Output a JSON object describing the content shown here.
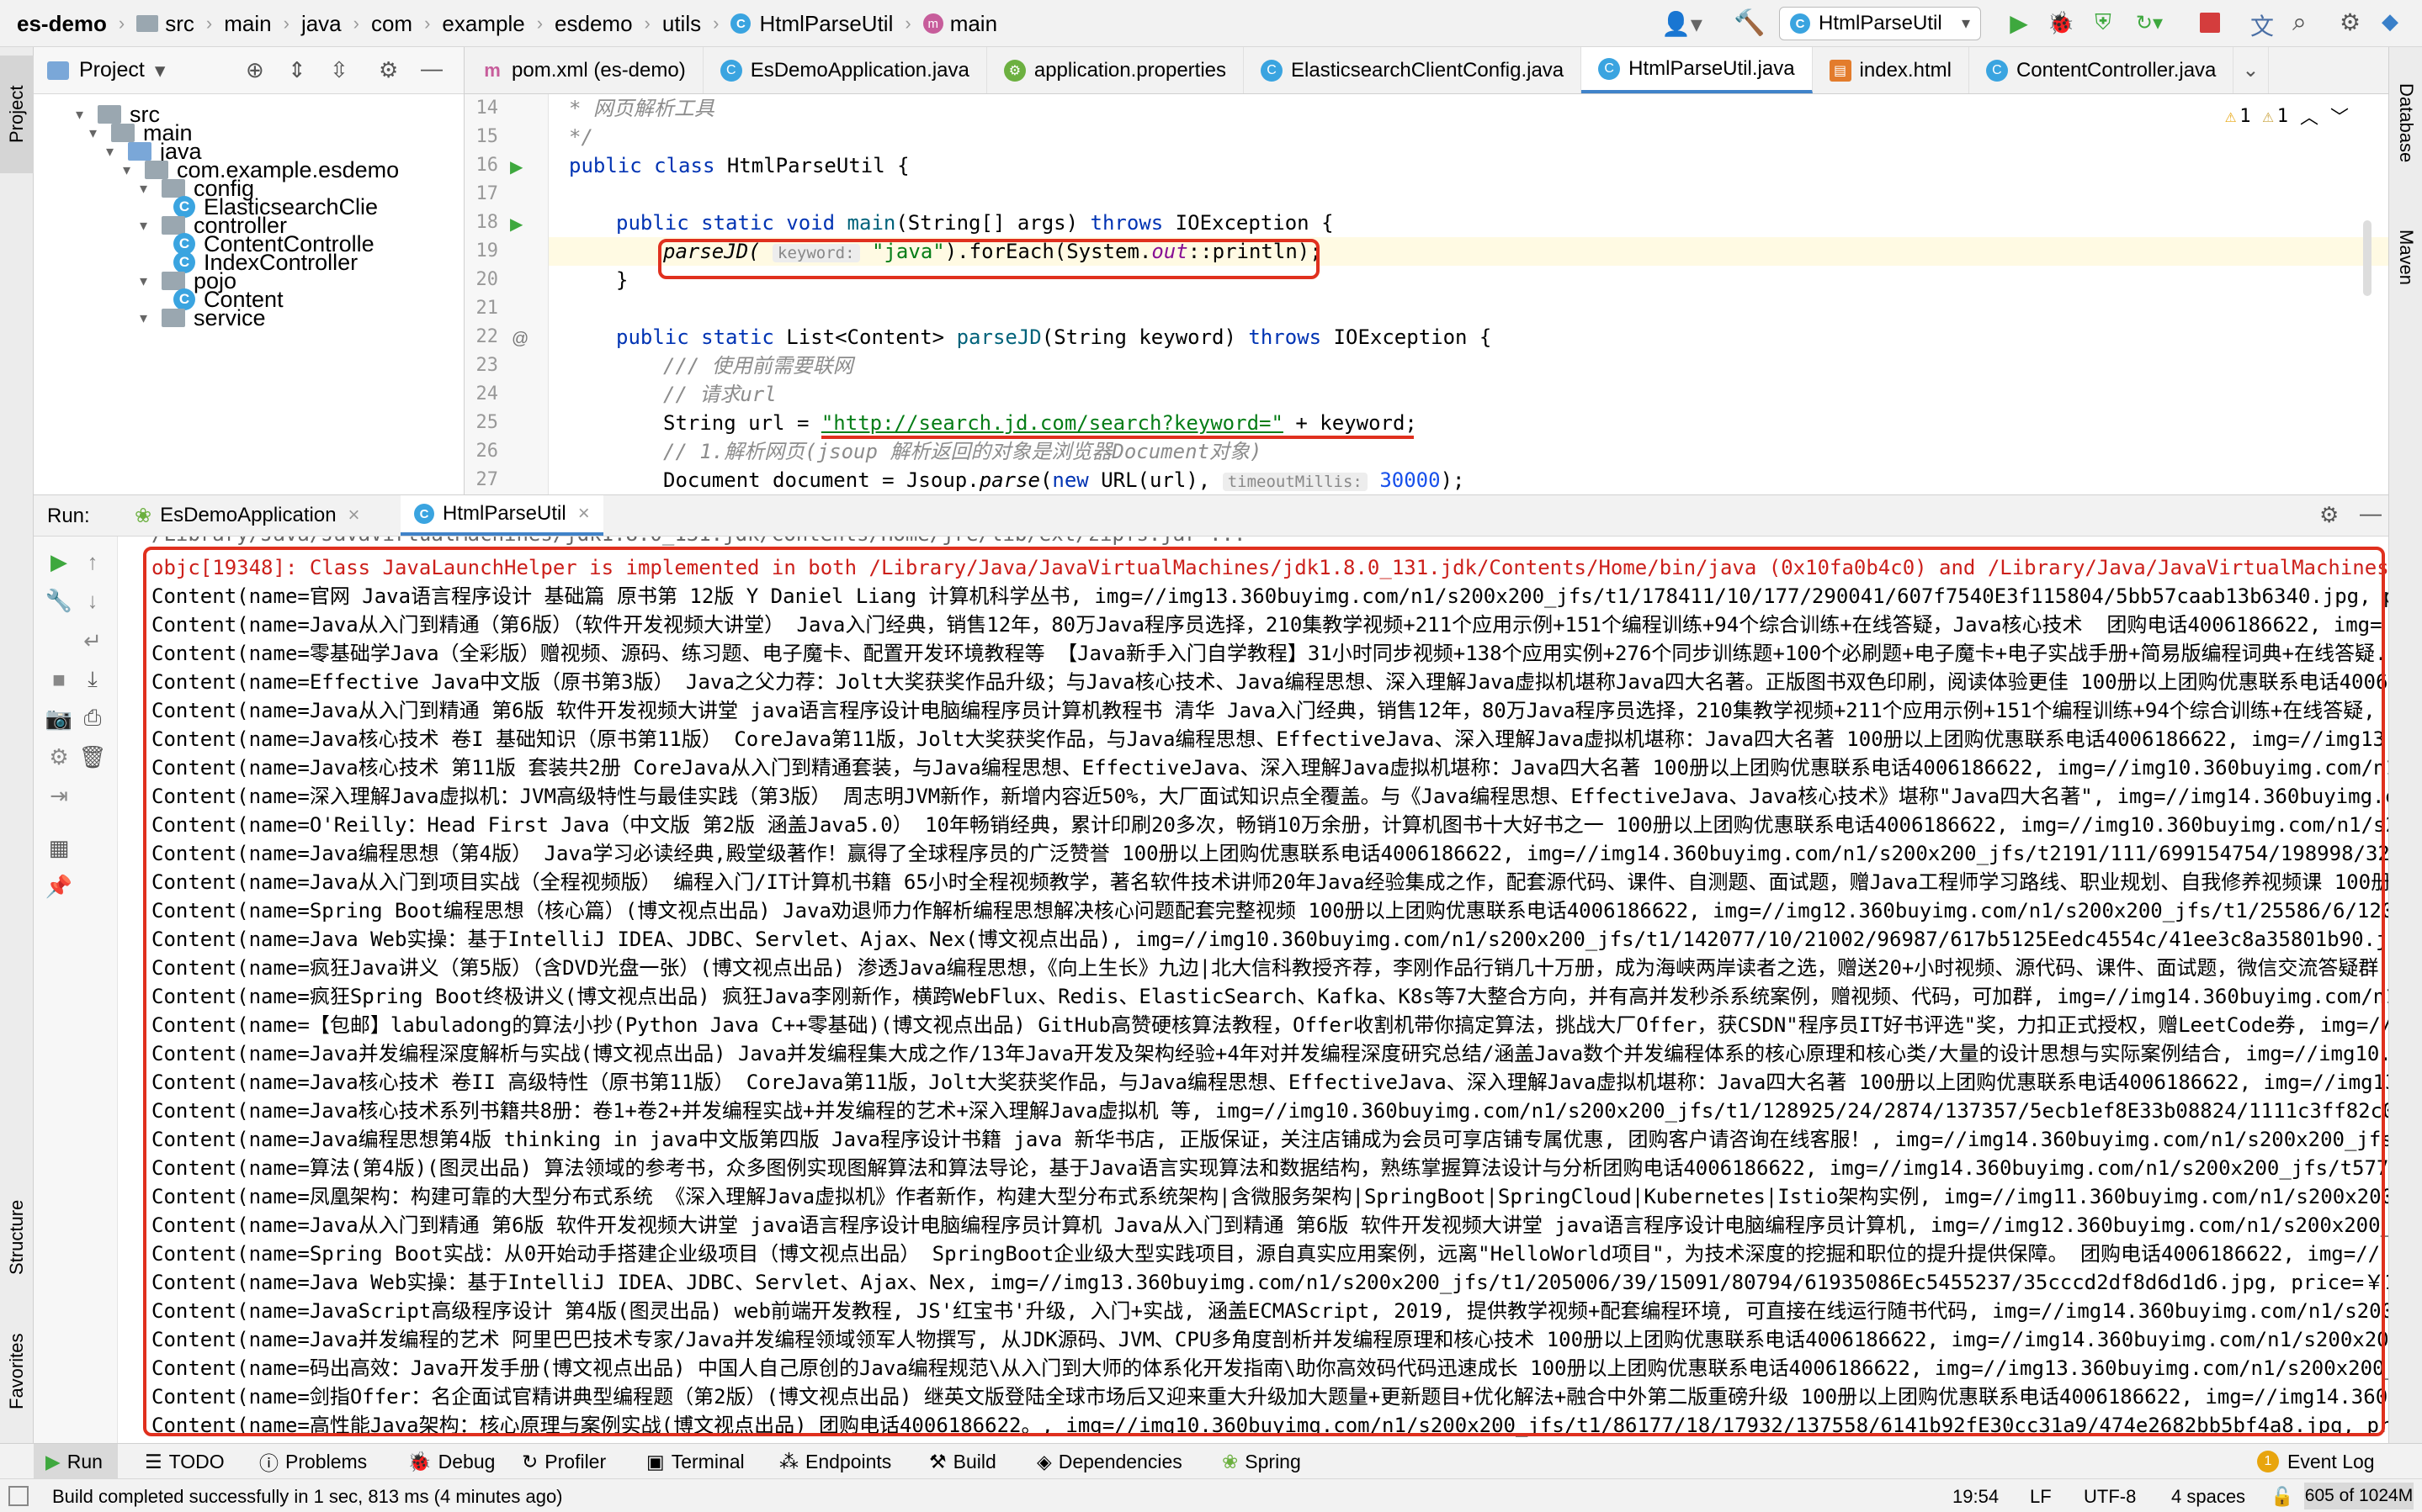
{
  "navbar": {
    "crumbs": [
      "es-demo",
      "src",
      "main",
      "java",
      "com",
      "example",
      "esdemo",
      "utils",
      "HtmlParseUtil",
      "main"
    ],
    "run_config": "HtmlParseUtil"
  },
  "left_strip": {
    "project": "Project",
    "structure": "Structure",
    "favorites": "Favorites"
  },
  "right_strip": {
    "database": "Database",
    "maven": "Maven"
  },
  "project": {
    "title": "Project",
    "tree": [
      {
        "label": "src",
        "type": "folder"
      },
      {
        "label": "main",
        "type": "folder"
      },
      {
        "label": "java",
        "type": "folder-blue"
      },
      {
        "label": "com.example.esdemo",
        "type": "package"
      },
      {
        "label": "config",
        "type": "package"
      },
      {
        "label": "ElasticsearchClie",
        "type": "class"
      },
      {
        "label": "controller",
        "type": "package"
      },
      {
        "label": "ContentControlle",
        "type": "class"
      },
      {
        "label": "IndexController",
        "type": "class"
      },
      {
        "label": "pojo",
        "type": "package"
      },
      {
        "label": "Content",
        "type": "class"
      },
      {
        "label": "service",
        "type": "package"
      }
    ]
  },
  "tabs": [
    {
      "label": "pom.xml (es-demo)",
      "icon": "maven-icon"
    },
    {
      "label": "EsDemoApplication.java",
      "icon": "spring-class-icon"
    },
    {
      "label": "application.properties",
      "icon": "properties-icon"
    },
    {
      "label": "ElasticsearchClientConfig.java",
      "icon": "class-icon"
    },
    {
      "label": "HtmlParseUtil.java",
      "icon": "class-icon"
    },
    {
      "label": "index.html",
      "icon": "html-icon"
    },
    {
      "label": "ContentController.java",
      "icon": "class-icon"
    }
  ],
  "editor": {
    "line_numbers": [
      "14",
      "15",
      "16",
      "17",
      "18",
      "19",
      "20",
      "21",
      "22",
      "23",
      "24",
      "25",
      "26",
      "27"
    ],
    "inspections": {
      "warnings": "1",
      "weak_warnings": "1"
    },
    "lines": {
      "l14": "* 网页解析工具",
      "l15": "*/",
      "l16a": "public class",
      "l16b": " HtmlParseUtil {",
      "l18a": "public static void",
      "l18b": " main",
      "l18c": "(String[] args) ",
      "l18d": "throws",
      "l18e": " IOException {",
      "l19a": "parseJD(",
      "l19hint": "keyword:",
      "l19str": "\"java\"",
      "l19b": ").forEach(System.",
      "l19fld": "out",
      "l19c": "::println);",
      "l20": "}",
      "l22a": "public static",
      "l22b": " List<Content> ",
      "l22c": "parseJD",
      "l22d": "(String keyword) ",
      "l22e": "throws",
      "l22f": " IOException {",
      "l23": "/// 使用前需要联网",
      "l24": "// 请求url",
      "l25a": "String url = ",
      "l25str": "\"http://search.jd.com/search?keyword=\"",
      "l25b": " + keyword;",
      "l26": "// 1.解析网页(jsoup 解析返回的对象是浏览器Document对象)",
      "l27a": "Document document = Jsoup.",
      "l27b": "parse",
      "l27c": "(",
      "l27d": "new",
      "l27e": " URL(url),",
      "l27hint": "timeoutMillis:",
      "l27num": "30000",
      "l27f": ");"
    }
  },
  "run": {
    "label": "Run:",
    "tabs": [
      "EsDemoApplication",
      "HtmlParseUtil"
    ]
  },
  "console": {
    "partial_top": "/Library/Java/JavaVirtualMachines/jdk1.8.0_131.jdk/Contents/Home/jre/lib/ext/zipfs.jar ...",
    "lines": [
      "objc[19348]: Class JavaLaunchHelper is implemented in both /Library/Java/JavaVirtualMachines/jdk1.8.0_131.jdk/Contents/Home/bin/java (0x10fa0b4c0) and /Library/Java/JavaVirtualMachines/",
      "Content(name=官网 Java语言程序设计 基础篇 原书第 12版 Y Daniel Liang 计算机科学丛书, img=//img13.360buyimg.com/n1/s200x200_jfs/t1/178411/10/177/290041/607f7540E3f115804/5bb57caab13b6340.jpg, p",
      "Content(name=Java从入门到精通（第6版）（软件开发视频大讲堂） Java入门经典，销售12年，80万Java程序员选择，210集教学视频+211个应用示例+151个编程训练+94个综合训练+在线答疑，Java核心技术  团购电话4006186622, img=",
      "Content(name=零基础学Java（全彩版）赠视频、源码、练习题、电子魔卡、配置开发环境教程等 【Java新手入门自学教程】31小时同步视频+138个应用实例+276个同步训练题+100个必刷题+电子魔卡+电子实战手册+简易版编程词典+在线答疑.",
      "Content(name=Effective Java中文版（原书第3版） Java之父力荐：Jolt大奖获奖作品升级；与Java核心技术、Java编程思想、深入理解Java虚拟机堪称Java四大名著。正版图书双色印刷，阅读体验更佳 100册以上团购优惠联系电话4006",
      "Content(name=Java从入门到精通 第6版 软件开发视频大讲堂 java语言程序设计电脑编程序员计算机教程书 清华 Java入门经典，销售12年，80万Java程序员选择，210集教学视频+211个应用示例+151个编程训练+94个综合训练+在线答疑,",
      "Content(name=Java核心技术 卷I 基础知识（原书第11版） CoreJava第11版，Jolt大奖获奖作品，与Java编程思想、EffectiveJava、深入理解Java虚拟机堪称：Java四大名著 100册以上团购优惠联系电话4006186622, img=//img13.",
      "Content(name=Java核心技术 第11版 套装共2册 CoreJava从入门到精通套装，与Java编程思想、EffectiveJava、深入理解Java虚拟机堪称：Java四大名著 100册以上团购优惠联系电话4006186622, img=//img10.360buyimg.com/n1",
      "Content(name=深入理解Java虚拟机：JVM高级特性与最佳实践（第3版） 周志明JVM新作，新增内容近50%，大厂面试知识点全覆盖。与《Java编程思想、EffectiveJava、Java核心技术》堪称\"Java四大名著\", img=//img14.360buyimg.c",
      "Content(name=O'Reilly：Head First Java（中文版 第2版 涵盖Java5.0） 10年畅销经典，累计印刷20多次，畅销10万余册，计算机图书十大好书之一 100册以上团购优惠联系电话4006186622, img=//img10.360buyimg.com/n1/s2",
      "Content(name=Java编程思想（第4版） Java学习必读经典,殿堂级著作！赢得了全球程序员的广泛赞誉 100册以上团购优惠联系电话4006186622, img=//img14.360buyimg.com/n1/s200x200_jfs/t2191/111/699154754/198998/32",
      "Content(name=Java从入门到项目实战（全程视频版） 编程入门/IT计算机书籍 65小时全程视频教学，著名软件技术讲师20年Java经验集成之作，配套源代码、课件、自测题、面试题，赠Java工程师学习路线、职业规划、自我修养视频课 100册",
      "Content(name=Spring Boot编程思想（核心篇）(博文视点出品) Java劝退师力作解析编程思想解决核心问题配套完整视频 100册以上团购优惠联系电话4006186622, img=//img12.360buyimg.com/n1/s200x200_jfs/t1/25586/6/120",
      "Content(name=Java Web实操：基于IntelliJ IDEA、JDBC、Servlet、Ajax、Nex(博文视点出品), img=//img10.360buyimg.com/n1/s200x200_jfs/t1/142077/10/21002/96987/617b5125Eedc4554c/41ee3c8a35801b90.jp",
      "Content(name=疯狂Java讲义（第5版）（含DVD光盘一张）(博文视点出品) 渗透Java编程思想，《向上生长》九边|北大信科教授齐荐，李刚作品行销几十万册，成为海峡两岸读者之选，赠送20+小时视频、源代码、课件、面试题，微信交流答疑群",
      "Content(name=疯狂Spring Boot终极讲义(博文视点出品) 疯狂Java李刚新作，横跨WebFlux、Redis、ElasticSearch、Kafka、K8s等7大整合方向，并有高并发秒杀系统案例，赠视频、代码，可加群, img=//img14.360buyimg.com/n1/s2",
      "Content(name=【包邮】labuladong的算法小抄(Python Java C++零基础)(博文视点出品) GitHub高赞硬核算法教程，Offer收割机带你搞定算法，挑战大厂Offer，获CSDN\"程序员IT好书评选\"奖，力扣正式授权，赠LeetCode券, img=//",
      "Content(name=Java并发编程深度解析与实战(博文视点出品) Java并发编程集大成之作/13年Java开发及架构经验+4年对并发编程深度研究总结/涵盖Java数个并发编程体系的核心原理和核心类/大量的设计思想与实际案例结合, img=//img10.3",
      "Content(name=Java核心技术 卷II 高级特性（原书第11版） CoreJava第11版，Jolt大奖获奖作品，与Java编程思想、EffectiveJava、深入理解Java虚拟机堪称：Java四大名著 100册以上团购优惠联系电话4006186622, img=//img13",
      "Content(name=Java核心技术系列书籍共8册：卷1+卷2+并发编程实战+并发编程的艺术+深入理解Java虚拟机 等, img=//img10.360buyimg.com/n1/s200x200_jfs/t1/128925/24/2874/137357/5ecb1ef8E33b08824/1111c3ff82c0",
      "Content(name=Java编程思想第4版 thinking in java中文版第四版 Java程序设计书籍 java 新华书店, 正版保证，关注店铺成为会员可享店铺专属优惠, 团购客户请咨询在线客服！, img=//img14.360buyimg.com/n1/s200x200_jfs,",
      "Content(name=算法(第4版)(图灵出品) 算法领域的参考书，众多图例实现图解算法和算法导论，基于Java语言实现算法和数据结构，熟练掌握算法设计与分析团购电话4006186622, img=//img14.360buyimg.com/n1/s200x200_jfs/t577",
      "Content(name=凤凰架构：构建可靠的大型分布式系统 《深入理解Java虚拟机》作者新作，构建大型分布式系统架构|含微服务架构|SpringBoot|SpringCloud|Kubernetes|Istio架构实例, img=//img11.360buyimg.com/n1/s200x200",
      "Content(name=Java从入门到精通 第6版 软件开发视频大讲堂 java语言程序设计电脑编程序员计算机 Java从入门到精通 第6版 软件开发视频大讲堂 java语言程序设计电脑编程序员计算机, img=//img12.360buyimg.com/n1/s200x200_",
      "Content(name=Spring Boot实战：从0开始动手搭建企业级项目（博文视点出品） SpringBoot企业级大型实践项目，源自真实应用案例，远离\"HelloWorld项目\"，为技术深度的挖掘和职位的提升提供保障。 团购电话4006186622, img=//",
      "Content(name=Java Web实操：基于IntelliJ IDEA、JDBC、Servlet、Ajax、Nex, img=//img13.360buyimg.com/n1/s200x200_jfs/t1/205006/39/15091/80794/61935086Ec5455237/35cccd2df8d6d1d6.jpg, price=￥1",
      "Content(name=JavaScript高级程序设计 第4版(图灵出品) web前端开发教程, JS'红宝书'升级, 入门+实战, 涵盖ECMAScript, 2019, 提供教学视频+配套编程环境, 可直接在线运行随书代码, img=//img14.360buyimg.com/n1/s200x",
      "Content(name=Java并发编程的艺术 阿里巴巴技术专家/Java并发编程领域领军人物撰写, 从JDK源码、JVM、CPU多角度剖析并发编程原理和核心技术 100册以上团购优惠联系电话4006186622, img=//img14.360buyimg.com/n1/s200x200",
      "Content(name=码出高效：Java开发手册(博文视点出品) 中国人自己原创的Java编程规范\\从入门到大师的体系化开发指南\\助你高效码代码迅速成长 100册以上团购优惠联系电话4006186622, img=//img13.360buyimg.com/n1/s200x200_",
      "Content(name=剑指Offer：名企面试官精讲典型编程题（第2版）(博文视点出品) 继英文版登陆全球市场后又迎来重大升级加大题量+更新题目+优化解法+融合中外第二版重磅升级 100册以上团购优惠联系电话4006186622, img=//img14.360",
      "Content(name=高性能Java架构：核心原理与案例实战(博文视点出品) 团购电话4006186622。, img=//img10.360buyimg.com/n1/s200x200_jfs/t1/86177/18/17932/137558/6141b92fE30cc31a9/474e2682bb5bf4a8.jpg, pr"
    ]
  },
  "bottom_tabs": [
    "Run",
    "TODO",
    "Problems",
    "Debug",
    "Profiler",
    "Terminal",
    "Endpoints",
    "Build",
    "Dependencies",
    "Spring",
    "Event Log"
  ],
  "event_log_count": "1",
  "status": {
    "message": "Build completed successfully in 1 sec, 813 ms (4 minutes ago)",
    "position": "19:54",
    "line_sep": "LF",
    "encoding": "UTF-8",
    "indent": "4 spaces",
    "memory": "605 of 1024M"
  },
  "colors": {
    "accent": "#4083c9",
    "highlight": "#e0301e",
    "run_green": "#3ea83e",
    "stop_red": "#d43d3d"
  }
}
